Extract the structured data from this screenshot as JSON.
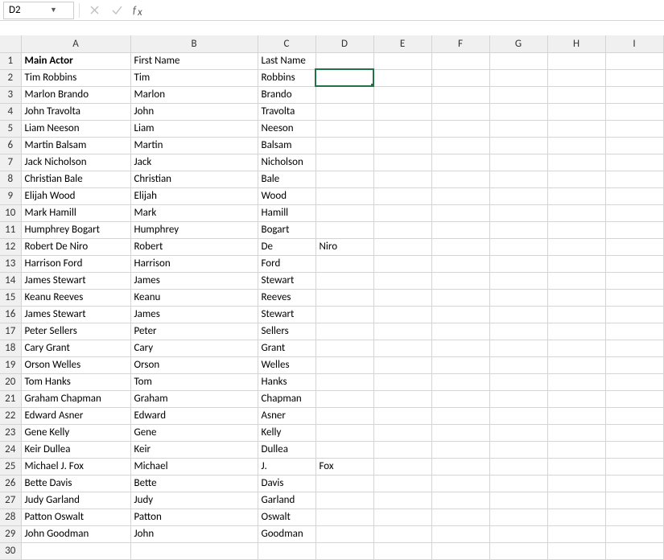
{
  "nameBox": "D2",
  "formula": "",
  "columns": [
    "A",
    "B",
    "C",
    "D",
    "E",
    "F",
    "G",
    "H",
    "I"
  ],
  "columnClasses": [
    "col-A",
    "col-B",
    "col-other",
    "col-other",
    "col-other",
    "col-other",
    "col-other",
    "col-other",
    "col-other"
  ],
  "selected": {
    "row": 2,
    "col": "D"
  },
  "rows": [
    {
      "n": 1,
      "A": "Main Actor",
      "B": "First Name",
      "C": "Last Name",
      "D": "",
      "E": "",
      "F": "",
      "G": "",
      "H": "",
      "I": "",
      "boldA": true
    },
    {
      "n": 2,
      "A": "Tim Robbins",
      "B": "Tim",
      "C": "Robbins",
      "D": "",
      "E": "",
      "F": "",
      "G": "",
      "H": "",
      "I": ""
    },
    {
      "n": 3,
      "A": "Marlon Brando",
      "B": "Marlon",
      "C": "Brando",
      "D": "",
      "E": "",
      "F": "",
      "G": "",
      "H": "",
      "I": ""
    },
    {
      "n": 4,
      "A": "John Travolta",
      "B": "John",
      "C": "Travolta",
      "D": "",
      "E": "",
      "F": "",
      "G": "",
      "H": "",
      "I": ""
    },
    {
      "n": 5,
      "A": "Liam Neeson",
      "B": "Liam",
      "C": "Neeson",
      "D": "",
      "E": "",
      "F": "",
      "G": "",
      "H": "",
      "I": ""
    },
    {
      "n": 6,
      "A": "Martin Balsam",
      "B": "Martin",
      "C": "Balsam",
      "D": "",
      "E": "",
      "F": "",
      "G": "",
      "H": "",
      "I": ""
    },
    {
      "n": 7,
      "A": "Jack Nicholson",
      "B": "Jack",
      "C": "Nicholson",
      "D": "",
      "E": "",
      "F": "",
      "G": "",
      "H": "",
      "I": ""
    },
    {
      "n": 8,
      "A": "Christian Bale",
      "B": "Christian",
      "C": "Bale",
      "D": "",
      "E": "",
      "F": "",
      "G": "",
      "H": "",
      "I": ""
    },
    {
      "n": 9,
      "A": "Elijah Wood",
      "B": "Elijah",
      "C": "Wood",
      "D": "",
      "E": "",
      "F": "",
      "G": "",
      "H": "",
      "I": ""
    },
    {
      "n": 10,
      "A": "Mark Hamill",
      "B": "Mark",
      "C": "Hamill",
      "D": "",
      "E": "",
      "F": "",
      "G": "",
      "H": "",
      "I": ""
    },
    {
      "n": 11,
      "A": "Humphrey Bogart",
      "B": "Humphrey",
      "C": "Bogart",
      "D": "",
      "E": "",
      "F": "",
      "G": "",
      "H": "",
      "I": ""
    },
    {
      "n": 12,
      "A": "Robert De Niro",
      "B": "Robert",
      "C": "De",
      "D": "Niro",
      "E": "",
      "F": "",
      "G": "",
      "H": "",
      "I": ""
    },
    {
      "n": 13,
      "A": "Harrison Ford",
      "B": "Harrison",
      "C": "Ford",
      "D": "",
      "E": "",
      "F": "",
      "G": "",
      "H": "",
      "I": ""
    },
    {
      "n": 14,
      "A": "James Stewart",
      "B": "James",
      "C": "Stewart",
      "D": "",
      "E": "",
      "F": "",
      "G": "",
      "H": "",
      "I": ""
    },
    {
      "n": 15,
      "A": "Keanu Reeves",
      "B": "Keanu",
      "C": "Reeves",
      "D": "",
      "E": "",
      "F": "",
      "G": "",
      "H": "",
      "I": ""
    },
    {
      "n": 16,
      "A": "James Stewart",
      "B": "James",
      "C": "Stewart",
      "D": "",
      "E": "",
      "F": "",
      "G": "",
      "H": "",
      "I": ""
    },
    {
      "n": 17,
      "A": "Peter Sellers",
      "B": "Peter",
      "C": "Sellers",
      "D": "",
      "E": "",
      "F": "",
      "G": "",
      "H": "",
      "I": ""
    },
    {
      "n": 18,
      "A": "Cary Grant",
      "B": "Cary",
      "C": "Grant",
      "D": "",
      "E": "",
      "F": "",
      "G": "",
      "H": "",
      "I": ""
    },
    {
      "n": 19,
      "A": "Orson Welles",
      "B": "Orson",
      "C": "Welles",
      "D": "",
      "E": "",
      "F": "",
      "G": "",
      "H": "",
      "I": ""
    },
    {
      "n": 20,
      "A": "Tom Hanks",
      "B": "Tom",
      "C": "Hanks",
      "D": "",
      "E": "",
      "F": "",
      "G": "",
      "H": "",
      "I": ""
    },
    {
      "n": 21,
      "A": "Graham Chapman",
      "B": "Graham",
      "C": "Chapman",
      "D": "",
      "E": "",
      "F": "",
      "G": "",
      "H": "",
      "I": ""
    },
    {
      "n": 22,
      "A": "Edward Asner",
      "B": "Edward",
      "C": "Asner",
      "D": "",
      "E": "",
      "F": "",
      "G": "",
      "H": "",
      "I": ""
    },
    {
      "n": 23,
      "A": "Gene Kelly",
      "B": "Gene",
      "C": "Kelly",
      "D": "",
      "E": "",
      "F": "",
      "G": "",
      "H": "",
      "I": ""
    },
    {
      "n": 24,
      "A": "Keir Dullea",
      "B": "Keir",
      "C": "Dullea",
      "D": "",
      "E": "",
      "F": "",
      "G": "",
      "H": "",
      "I": ""
    },
    {
      "n": 25,
      "A": "Michael J. Fox",
      "B": "Michael",
      "C": "J.",
      "D": "Fox",
      "E": "",
      "F": "",
      "G": "",
      "H": "",
      "I": ""
    },
    {
      "n": 26,
      "A": "Bette Davis",
      "B": "Bette",
      "C": "Davis",
      "D": "",
      "E": "",
      "F": "",
      "G": "",
      "H": "",
      "I": ""
    },
    {
      "n": 27,
      "A": "Judy Garland",
      "B": "Judy",
      "C": "Garland",
      "D": "",
      "E": "",
      "F": "",
      "G": "",
      "H": "",
      "I": ""
    },
    {
      "n": 28,
      "A": "Patton Oswalt",
      "B": "Patton",
      "C": "Oswalt",
      "D": "",
      "E": "",
      "F": "",
      "G": "",
      "H": "",
      "I": ""
    },
    {
      "n": 29,
      "A": "John Goodman",
      "B": "John",
      "C": "Goodman",
      "D": "",
      "E": "",
      "F": "",
      "G": "",
      "H": "",
      "I": ""
    },
    {
      "n": 30,
      "A": "",
      "B": "",
      "C": "",
      "D": "",
      "E": "",
      "F": "",
      "G": "",
      "H": "",
      "I": ""
    }
  ]
}
